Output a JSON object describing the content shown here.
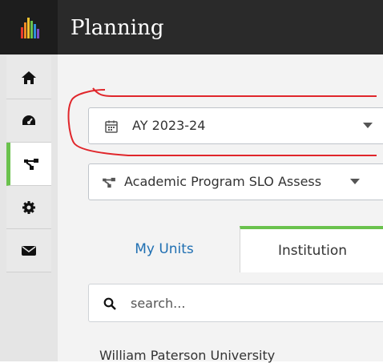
{
  "header": {
    "title": "Planning"
  },
  "sidebar": {
    "items": [
      {
        "icon": "home-icon"
      },
      {
        "icon": "dashboard-icon"
      },
      {
        "icon": "planning-icon"
      },
      {
        "icon": "settings-icon"
      },
      {
        "icon": "mail-icon"
      }
    ],
    "active_accent": "#6ac24d"
  },
  "filters": {
    "year": "AY 2023-24",
    "plan": "Academic Program SLO Assess"
  },
  "tabs": [
    {
      "label": "My Units"
    },
    {
      "label": "Institution"
    }
  ],
  "search": {
    "placeholder": "search..."
  },
  "list": {
    "first_item": "William Paterson University"
  },
  "colors": {
    "topbar": "#2a2a2a",
    "accent_green": "#6ac24d",
    "link_blue": "#1f6fb2",
    "annotation_red": "#e0262b"
  }
}
